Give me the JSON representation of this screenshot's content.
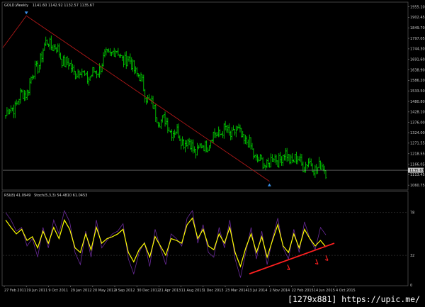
{
  "header": {
    "symbol": "GOLD,Weekly",
    "ohlc": "1141.60  1142.92  1132.57  1135.67",
    "indicator": "RSI(8) 41.0949",
    "stoch": "Stoch(5,3,3)  54.4810  61.0453"
  },
  "price_axis": {
    "ticks": [
      "1955.10",
      "1902.45",
      "1849.70",
      "1797.05",
      "1744.30",
      "1691.60",
      "1638.90",
      "1586.20",
      "1533.50",
      "1480.80",
      "1428.10",
      "1376.00",
      "1324.00",
      "1271.55",
      "1218.55",
      "1166.05",
      "1113.45",
      "1060.75"
    ],
    "current_price": "1135.67"
  },
  "osc_axis": {
    "ticks": [
      "78",
      "32",
      "0"
    ]
  },
  "time_axis": {
    "ticks": [
      "27 Feb 2011",
      "19 Jun 2011",
      "9 Oct 2011",
      "29 Jan 2012",
      "20 May 2012",
      "9 Sep 2012",
      "30 Dec 2012",
      "21 Apr 2013",
      "11 Aug 2013",
      "1 Dec 2013",
      "23 Mar 2014",
      "13 Jul 2014",
      "2 Nov 2014",
      "22 Feb 2015",
      "14 Jun 2015",
      "4 Oct 2015"
    ]
  },
  "watermark": "[1279x881] https://upic.me/",
  "colors": {
    "background": "#000000",
    "bull_bar": "#00e000",
    "trendline": "#b01818",
    "rsi": "#ffff00",
    "stoch": "#6a2a9a",
    "support_line": "#ff2020",
    "arrow_marker": "#3a8fe8"
  },
  "chart_data": [
    {
      "type": "line",
      "title": "GOLD,Weekly",
      "x": [
        "27 Feb 2011",
        "19 Jun 2011",
        "9 Oct 2011",
        "29 Jan 2012",
        "20 May 2012",
        "9 Sep 2012",
        "30 Dec 2012",
        "21 Apr 2013",
        "11 Aug 2013",
        "1 Dec 2013",
        "23 Mar 2014",
        "13 Jul 2014",
        "2 Nov 2014",
        "22 Feb 2015",
        "14 Jun 2015",
        "4 Oct 2015"
      ],
      "series": [
        {
          "values": [
            1410,
            1540,
            1790,
            1650,
            1600,
            1740,
            1660,
            1420,
            1320,
            1230,
            1330,
            1320,
            1160,
            1210,
            1170,
            1140
          ]
        }
      ],
      "ylim": [
        1040,
        1975
      ],
      "current_price": 1135.67,
      "trendline": [
        {
          "x": "19 Jun 2011",
          "y": 1910
        },
        {
          "x": "2 Nov 2014",
          "y": 1080
        }
      ]
    },
    {
      "type": "line",
      "title": "RSI(8) 41.0949  Stoch(5,3,3) 54.4810 61.0453",
      "series": [
        {
          "values": [
            70,
            62,
            55,
            60,
            48,
            52,
            40,
            58,
            45,
            62,
            50,
            70,
            60,
            40,
            35,
            55,
            38,
            62,
            45,
            50,
            52,
            55,
            60,
            35,
            25,
            38,
            45,
            30,
            52,
            42,
            32,
            50,
            48,
            45,
            65,
            72,
            50,
            60,
            42,
            38,
            55,
            45,
            62,
            35,
            20,
            40,
            55,
            35,
            52,
            30,
            48,
            65,
            42,
            35,
            55,
            40,
            60,
            50,
            42,
            48,
            41
          ]
        },
        {
          "values": [
            78,
            70,
            58,
            62,
            42,
            50,
            30,
            62,
            40,
            70,
            55,
            80,
            68,
            35,
            22,
            58,
            30,
            70,
            40,
            48,
            55,
            58,
            66,
            28,
            12,
            35,
            46,
            20,
            60,
            40,
            22,
            55,
            50,
            42,
            72,
            80,
            45,
            65,
            35,
            30,
            62,
            40,
            70,
            28,
            8,
            35,
            62,
            28,
            58,
            22,
            50,
            72,
            40,
            28,
            60,
            35,
            68,
            50,
            38,
            62,
            54
          ]
        }
      ],
      "ylim": [
        0,
        100
      ]
    }
  ]
}
